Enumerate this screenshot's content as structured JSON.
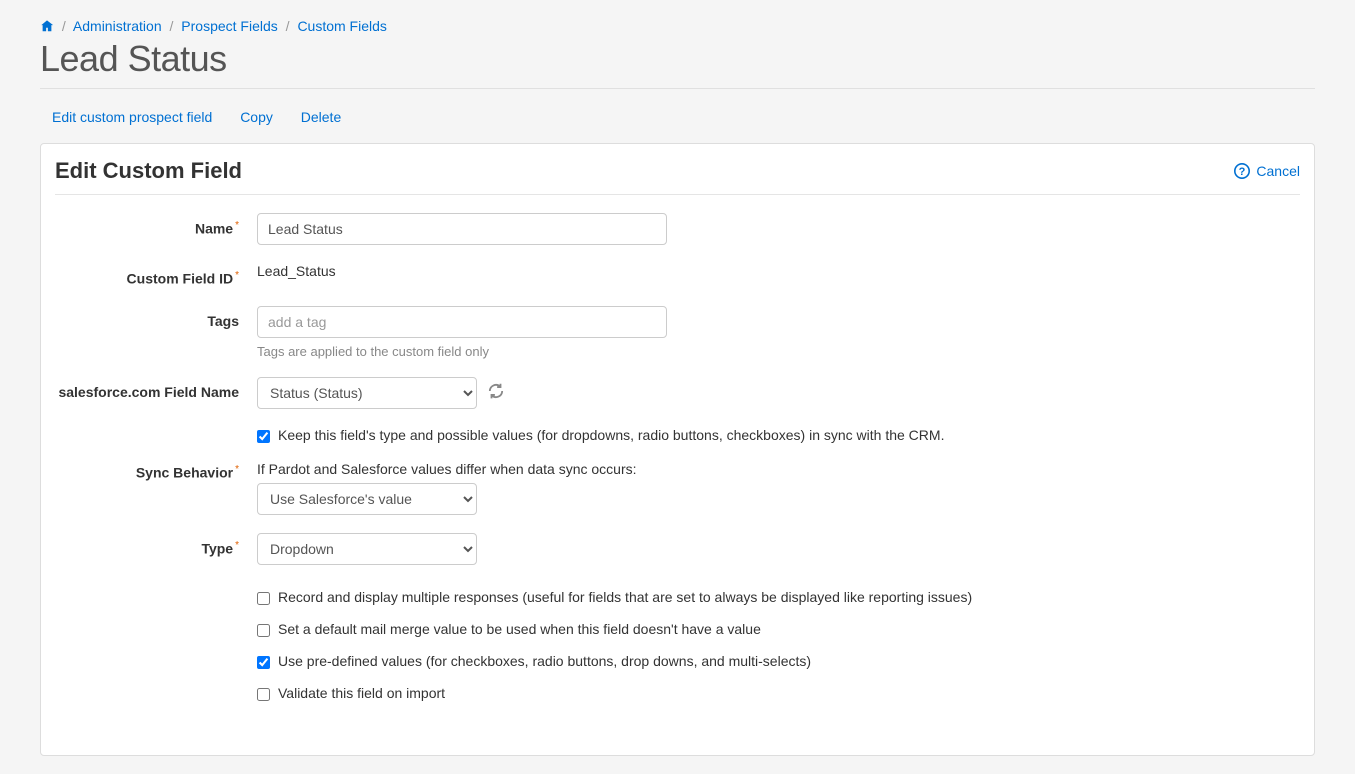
{
  "breadcrumb": {
    "home_label": "Home",
    "admin": "Administration",
    "prospect_fields": "Prospect Fields",
    "custom_fields": "Custom Fields"
  },
  "page_title": "Lead Status",
  "actions": {
    "edit": "Edit custom prospect field",
    "copy": "Copy",
    "delete": "Delete"
  },
  "panel": {
    "title": "Edit Custom Field",
    "cancel": "Cancel"
  },
  "form": {
    "name": {
      "label": "Name",
      "value": "Lead Status"
    },
    "custom_field_id": {
      "label": "Custom Field ID",
      "value": "Lead_Status"
    },
    "tags": {
      "label": "Tags",
      "placeholder": "add a tag",
      "help": "Tags are applied to the custom field only"
    },
    "sf_field": {
      "label": "salesforce.com Field Name",
      "value": "Status (Status)"
    },
    "keep_sync": {
      "label": "Keep this field's type and possible values (for dropdowns, radio buttons, checkboxes) in sync with the CRM.",
      "checked": true
    },
    "sync_behavior": {
      "label": "Sync Behavior",
      "note": "If Pardot and Salesforce values differ when data sync occurs:",
      "value": "Use Salesforce's value"
    },
    "type": {
      "label": "Type",
      "value": "Dropdown"
    },
    "options": {
      "record_multiple": {
        "label": "Record and display multiple responses (useful for fields that are set to always be displayed like reporting issues)",
        "checked": false
      },
      "default_merge": {
        "label": "Set a default mail merge value to be used when this field doesn't have a value",
        "checked": false
      },
      "predefined": {
        "label": "Use pre-defined values (for checkboxes, radio buttons, drop downs, and multi-selects)",
        "checked": true
      },
      "validate": {
        "label": "Validate this field on import",
        "checked": false
      }
    }
  }
}
